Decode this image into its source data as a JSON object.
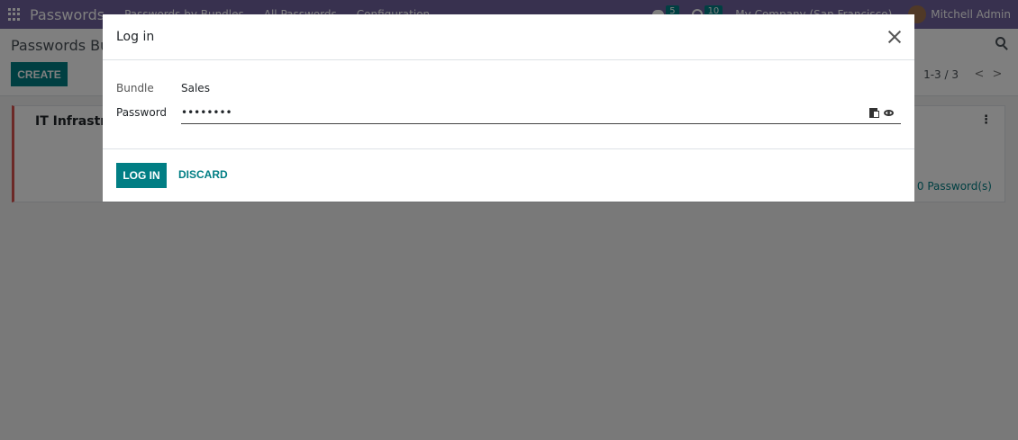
{
  "navbar": {
    "brand": "Passwords",
    "menu": [
      "Passwords by Bundles",
      "All Passwords",
      "Configuration"
    ],
    "messages_count": "5",
    "activities_count": "10",
    "company": "My Company (San Francisco)",
    "user": "Mitchell Admin"
  },
  "control_panel": {
    "breadcrumb": "Passwords Bundles",
    "create_label": "CREATE",
    "pager": "1-3 / 3",
    "prev": "<",
    "next": ">"
  },
  "card": {
    "title": "IT Infrastructure",
    "menu": "⋮",
    "count": "0 Password(s)"
  },
  "modal": {
    "title": "Log in",
    "bundle_label": "Bundle",
    "bundle_value": "Sales",
    "password_label": "Password",
    "password_value": "••••••••",
    "login_label": "LOG IN",
    "discard_label": "DISCARD"
  },
  "colors": {
    "navbar": "#71639e",
    "primary": "#017e84",
    "card_accent": "#d9534f"
  }
}
